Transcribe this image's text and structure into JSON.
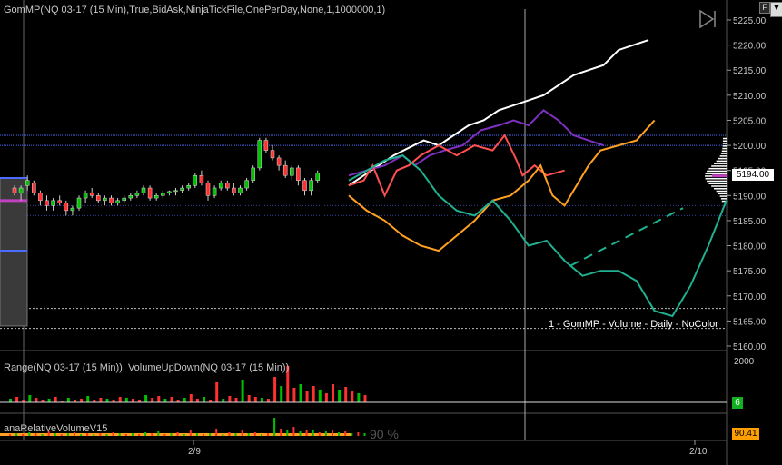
{
  "panel_title": "GomMP(NQ 03-17 (15 Min),True,BidAsk,NinjaTickFile,OnePerDay,None,1,1000000,1)",
  "indicator_label": "1 - GomMP - Volume - Daily - NoColor",
  "range_panel_title": "Range(NQ 03-17 (15 Min)), VolumeUpDown(NQ 03-17 (15 Min))",
  "relvol_panel_title": "anaRelativeVolumeV15",
  "relvol_watermark": "90 %",
  "price_box": "5194.00",
  "range_box": "6",
  "relvol_box": "90.41",
  "range_axis_label": "2000",
  "corner_button_f": "F",
  "corner_button_menu": "▼",
  "play_icon": "play-bar-icon",
  "colors": {
    "bg": "#000000",
    "up_candle": "#00c000",
    "down_candle": "#ff3030",
    "white_line": "#ffffff",
    "purple_line": "#8030c0",
    "red_line": "#ff5050",
    "orange_line": "#ffa020",
    "teal_line": "#20b090",
    "blue_level": "#4a6cff",
    "green_box": "#10b020",
    "orange_box": "#ffa000"
  },
  "chart_data": {
    "type": "line",
    "y_ticks": [
      "5225.00",
      "5220.00",
      "5215.00",
      "5210.00",
      "5205.00",
      "5200.00",
      "5195.00",
      "5190.00",
      "5185.00",
      "5180.00",
      "5175.00",
      "5170.00",
      "5165.00",
      "5160.00"
    ],
    "ylim": [
      5160,
      5225
    ],
    "x_ticks": [
      "2/9",
      "2/10"
    ],
    "candles": [
      {
        "o": 5191.5,
        "h": 5192,
        "l": 5190,
        "c": 5190.5
      },
      {
        "o": 5190.5,
        "h": 5192,
        "l": 5189,
        "c": 5191.5
      },
      {
        "o": 5192,
        "h": 5194,
        "l": 5191,
        "c": 5193
      },
      {
        "o": 5192.5,
        "h": 5193,
        "l": 5190,
        "c": 5190.5
      },
      {
        "o": 5190.5,
        "h": 5191,
        "l": 5188,
        "c": 5189
      },
      {
        "o": 5189,
        "h": 5190,
        "l": 5187,
        "c": 5188
      },
      {
        "o": 5188,
        "h": 5189.5,
        "l": 5187,
        "c": 5189
      },
      {
        "o": 5189,
        "h": 5190,
        "l": 5188,
        "c": 5188.5
      },
      {
        "o": 5188.5,
        "h": 5189,
        "l": 5186,
        "c": 5187
      },
      {
        "o": 5187,
        "h": 5188,
        "l": 5186,
        "c": 5187.5
      },
      {
        "o": 5187.5,
        "h": 5190,
        "l": 5187,
        "c": 5189.5
      },
      {
        "o": 5189.5,
        "h": 5191,
        "l": 5188.5,
        "c": 5190.5
      },
      {
        "o": 5190.5,
        "h": 5191.5,
        "l": 5189.5,
        "c": 5190
      },
      {
        "o": 5190,
        "h": 5190.5,
        "l": 5188.5,
        "c": 5189
      },
      {
        "o": 5189,
        "h": 5190,
        "l": 5188,
        "c": 5189.5
      },
      {
        "o": 5189.5,
        "h": 5190,
        "l": 5188,
        "c": 5188.5
      },
      {
        "o": 5188.5,
        "h": 5189.5,
        "l": 5188,
        "c": 5189
      },
      {
        "o": 5189,
        "h": 5190,
        "l": 5188.5,
        "c": 5189.5
      },
      {
        "o": 5189.5,
        "h": 5190.5,
        "l": 5189,
        "c": 5190
      },
      {
        "o": 5190,
        "h": 5191,
        "l": 5189.5,
        "c": 5190.5
      },
      {
        "o": 5190.5,
        "h": 5192,
        "l": 5190,
        "c": 5191.5
      },
      {
        "o": 5191.5,
        "h": 5192,
        "l": 5189,
        "c": 5189.5
      },
      {
        "o": 5189.5,
        "h": 5190.5,
        "l": 5189,
        "c": 5190
      },
      {
        "o": 5190,
        "h": 5191,
        "l": 5189.5,
        "c": 5190.5
      },
      {
        "o": 5190.5,
        "h": 5191,
        "l": 5190,
        "c": 5190.8
      },
      {
        "o": 5190.8,
        "h": 5191.5,
        "l": 5190,
        "c": 5191
      },
      {
        "o": 5191,
        "h": 5192,
        "l": 5190.5,
        "c": 5191.5
      },
      {
        "o": 5191.5,
        "h": 5192.5,
        "l": 5191,
        "c": 5192
      },
      {
        "o": 5192,
        "h": 5194.5,
        "l": 5191.5,
        "c": 5194
      },
      {
        "o": 5194,
        "h": 5195,
        "l": 5192,
        "c": 5192.5
      },
      {
        "o": 5192.5,
        "h": 5193,
        "l": 5189,
        "c": 5190
      },
      {
        "o": 5190,
        "h": 5192,
        "l": 5189.5,
        "c": 5191.5
      },
      {
        "o": 5191.5,
        "h": 5193,
        "l": 5191,
        "c": 5192.5
      },
      {
        "o": 5192.5,
        "h": 5193,
        "l": 5191,
        "c": 5191.5
      },
      {
        "o": 5191.5,
        "h": 5192.5,
        "l": 5190,
        "c": 5190.5
      },
      {
        "o": 5190.5,
        "h": 5192,
        "l": 5190,
        "c": 5191.5
      },
      {
        "o": 5191.5,
        "h": 5193.5,
        "l": 5191,
        "c": 5193
      },
      {
        "o": 5193,
        "h": 5196,
        "l": 5192.5,
        "c": 5195.5
      },
      {
        "o": 5195.5,
        "h": 5201.5,
        "l": 5195,
        "c": 5201
      },
      {
        "o": 5201,
        "h": 5201.5,
        "l": 5198.5,
        "c": 5199
      },
      {
        "o": 5199,
        "h": 5200,
        "l": 5197,
        "c": 5197.5
      },
      {
        "o": 5197.5,
        "h": 5198,
        "l": 5195,
        "c": 5196
      },
      {
        "o": 5196,
        "h": 5197,
        "l": 5193.5,
        "c": 5194
      },
      {
        "o": 5194,
        "h": 5196,
        "l": 5193,
        "c": 5195.5
      },
      {
        "o": 5195.5,
        "h": 5196,
        "l": 5192,
        "c": 5193
      },
      {
        "o": 5193,
        "h": 5193.5,
        "l": 5190,
        "c": 5191
      },
      {
        "o": 5191,
        "h": 5193.5,
        "l": 5190,
        "c": 5193
      },
      {
        "o": 5193,
        "h": 5195,
        "l": 5192.5,
        "c": 5194.5
      }
    ],
    "series": [
      {
        "color": "white",
        "values": [
          [
            0,
            5192
          ],
          [
            5,
            5194
          ],
          [
            10,
            5196
          ],
          [
            15,
            5198
          ],
          [
            20,
            5199.5
          ],
          [
            25,
            5201
          ],
          [
            30,
            5200
          ],
          [
            35,
            5202
          ],
          [
            40,
            5204
          ],
          [
            45,
            5205
          ],
          [
            50,
            5207
          ],
          [
            55,
            5208
          ],
          [
            60,
            5209
          ],
          [
            65,
            5210
          ],
          [
            70,
            5212
          ],
          [
            75,
            5214
          ],
          [
            80,
            5215
          ],
          [
            85,
            5216
          ],
          [
            90,
            5219
          ],
          [
            95,
            5220
          ],
          [
            100,
            5221
          ]
        ]
      },
      {
        "color": "purple",
        "values": [
          [
            0,
            5194
          ],
          [
            6,
            5195
          ],
          [
            12,
            5196
          ],
          [
            18,
            5198
          ],
          [
            22,
            5196
          ],
          [
            27,
            5198
          ],
          [
            32,
            5199
          ],
          [
            38,
            5200
          ],
          [
            44,
            5203
          ],
          [
            50,
            5204
          ],
          [
            55,
            5205
          ],
          [
            60,
            5204
          ],
          [
            65,
            5207
          ],
          [
            70,
            5205
          ],
          [
            75,
            5202
          ],
          [
            80,
            5201
          ],
          [
            85,
            5200
          ]
        ]
      },
      {
        "color": "red",
        "values": [
          [
            0,
            5192
          ],
          [
            5,
            5193
          ],
          [
            8,
            5196
          ],
          [
            12,
            5190
          ],
          [
            16,
            5195
          ],
          [
            20,
            5196
          ],
          [
            24,
            5198
          ],
          [
            30,
            5200
          ],
          [
            36,
            5198
          ],
          [
            42,
            5200
          ],
          [
            48,
            5199
          ],
          [
            52,
            5202
          ],
          [
            56,
            5197
          ],
          [
            58,
            5194
          ],
          [
            62,
            5196
          ],
          [
            66,
            5194
          ],
          [
            72,
            5195
          ]
        ]
      },
      {
        "color": "orange",
        "values": [
          [
            0,
            5190
          ],
          [
            6,
            5187
          ],
          [
            12,
            5185
          ],
          [
            18,
            5182
          ],
          [
            24,
            5180
          ],
          [
            30,
            5179
          ],
          [
            36,
            5182
          ],
          [
            42,
            5185
          ],
          [
            48,
            5189
          ],
          [
            54,
            5190
          ],
          [
            60,
            5193
          ],
          [
            64,
            5196
          ],
          [
            68,
            5190
          ],
          [
            72,
            5188
          ],
          [
            76,
            5192
          ],
          [
            80,
            5196
          ],
          [
            84,
            5199
          ],
          [
            90,
            5200
          ],
          [
            96,
            5201
          ],
          [
            102,
            5205
          ]
        ]
      },
      {
        "color": "teal",
        "values": [
          [
            0,
            5193
          ],
          [
            6,
            5195
          ],
          [
            12,
            5197
          ],
          [
            18,
            5198
          ],
          [
            24,
            5195
          ],
          [
            30,
            5190
          ],
          [
            36,
            5187
          ],
          [
            42,
            5186
          ],
          [
            48,
            5189
          ],
          [
            54,
            5185
          ],
          [
            60,
            5180
          ],
          [
            66,
            5181
          ],
          [
            72,
            5177
          ],
          [
            78,
            5174
          ],
          [
            84,
            5175
          ],
          [
            90,
            5175
          ],
          [
            96,
            5173
          ],
          [
            102,
            5167
          ],
          [
            108,
            5166
          ],
          [
            114,
            5172
          ],
          [
            120,
            5180
          ],
          [
            126,
            5189
          ]
        ]
      }
    ]
  }
}
